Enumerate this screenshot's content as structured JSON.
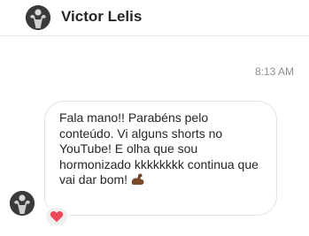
{
  "header": {
    "contact_name": "Victor Lelis",
    "avatar_icon": "profile-photo-flexing-icon"
  },
  "conversation": {
    "timestamp": "8:13 AM",
    "message": {
      "text": "Fala mano!! Parabéns pelo conteúdo. Vi alguns shorts no YouTube! E olha que sou hormonizado kkkkkkkk continua que vai dar bom!",
      "emoji_icon": "flexed-biceps-icon",
      "reaction_icon": "red-heart-icon"
    }
  },
  "colors": {
    "text": "#262626",
    "muted": "#8e8e8e",
    "bubble_border": "#e3e3e3",
    "heart": "#ed4956",
    "biceps": "#7a4a2a"
  }
}
